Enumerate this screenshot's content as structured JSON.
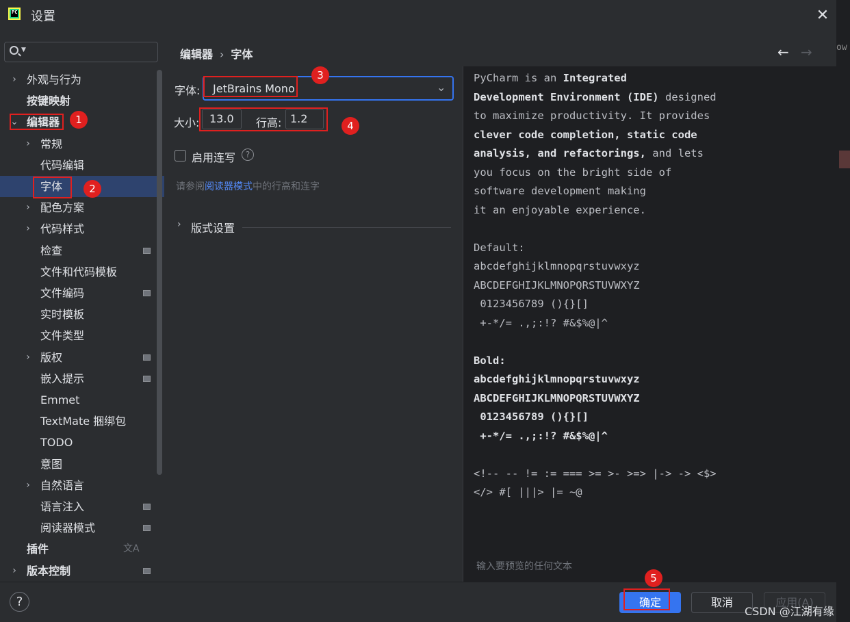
{
  "window": {
    "title": "设置",
    "logo_text": "PC",
    "close_glyph": "✕"
  },
  "sidebar": {
    "search_placeholder": "",
    "items": [
      {
        "label": "外观与行为",
        "arrow": "›",
        "level": 0
      },
      {
        "label": "按键映射",
        "arrow": "",
        "level": 0,
        "bold": true
      },
      {
        "label": "编辑器",
        "arrow": "⌄",
        "level": 0,
        "bold": true
      },
      {
        "label": "常规",
        "arrow": "›",
        "level": 1
      },
      {
        "label": "代码编辑",
        "arrow": "",
        "level": 1
      },
      {
        "label": "字体",
        "arrow": "",
        "level": 1,
        "selected": true
      },
      {
        "label": "配色方案",
        "arrow": "›",
        "level": 1
      },
      {
        "label": "代码样式",
        "arrow": "›",
        "level": 1
      },
      {
        "label": "检查",
        "arrow": "",
        "level": 1,
        "badge": true
      },
      {
        "label": "文件和代码模板",
        "arrow": "",
        "level": 1
      },
      {
        "label": "文件编码",
        "arrow": "",
        "level": 1,
        "badge": true
      },
      {
        "label": "实时模板",
        "arrow": "",
        "level": 1
      },
      {
        "label": "文件类型",
        "arrow": "",
        "level": 1
      },
      {
        "label": "版权",
        "arrow": "›",
        "level": 1,
        "badge": true
      },
      {
        "label": "嵌入提示",
        "arrow": "",
        "level": 1,
        "badge": true
      },
      {
        "label": "Emmet",
        "arrow": "",
        "level": 1
      },
      {
        "label": "TextMate 捆绑包",
        "arrow": "",
        "level": 1
      },
      {
        "label": "TODO",
        "arrow": "",
        "level": 1
      },
      {
        "label": "意图",
        "arrow": "",
        "level": 1
      },
      {
        "label": "自然语言",
        "arrow": "›",
        "level": 1
      },
      {
        "label": "语言注入",
        "arrow": "",
        "level": 1,
        "badge": true
      },
      {
        "label": "阅读器模式",
        "arrow": "",
        "level": 1,
        "badge": true
      },
      {
        "label": "插件",
        "arrow": "",
        "level": 0,
        "bold": true,
        "translate": true
      },
      {
        "label": "版本控制",
        "arrow": "›",
        "level": 0,
        "bold": true,
        "badge": true
      }
    ]
  },
  "header": {
    "breadcrumb": [
      "编辑器",
      "字体"
    ],
    "breadcrumb_sep": "›",
    "back_glyph": "←",
    "forward_glyph": "→"
  },
  "font_settings": {
    "font_label": "字体:",
    "font_value": "JetBrains Mono",
    "size_label": "大小:",
    "size_value": "13.0",
    "line_height_label": "行高:",
    "line_height_value": "1.2",
    "ligatures_label": "启用连写",
    "ligatures_checked": false,
    "hint_prefix": "请参阅",
    "hint_link": "阅读器模式",
    "hint_suffix": "中的行高和连字",
    "layout_section": "版式设置"
  },
  "preview": {
    "footer_placeholder": "输入要预览的任何文本",
    "lines": [
      [
        [
          "PyCharm is an ",
          false
        ],
        [
          "Integrated",
          true
        ]
      ],
      [
        [
          "Development Environment (IDE)",
          true
        ],
        [
          " designed",
          false
        ]
      ],
      [
        [
          "to maximize productivity. It provides",
          false
        ]
      ],
      [
        [
          "clever code completion, static code",
          true
        ]
      ],
      [
        [
          "analysis, and refactorings,",
          true
        ],
        [
          " and lets",
          false
        ]
      ],
      [
        [
          "you focus on the bright side of",
          false
        ]
      ],
      [
        [
          "software development making",
          false
        ]
      ],
      [
        [
          "it an enjoyable experience.",
          false
        ]
      ],
      [
        [
          "",
          false
        ]
      ],
      [
        [
          "Default:",
          false
        ]
      ],
      [
        [
          "abcdefghijklmnopqrstuvwxyz",
          false
        ]
      ],
      [
        [
          "ABCDEFGHIJKLMNOPQRSTUVWXYZ",
          false
        ]
      ],
      [
        [
          " 0123456789 (){}[]",
          false
        ]
      ],
      [
        [
          " +-*/= .,;:!? #&$%@|^",
          false
        ]
      ],
      [
        [
          "",
          false
        ]
      ],
      [
        [
          "Bold:",
          true
        ]
      ],
      [
        [
          "abcdefghijklmnopqrstuvwxyz",
          true
        ]
      ],
      [
        [
          "ABCDEFGHIJKLMNOPQRSTUVWXYZ",
          true
        ]
      ],
      [
        [
          " 0123456789 (){}[]",
          true
        ]
      ],
      [
        [
          " +-*/= .,;:!? #&$%@|^",
          true
        ]
      ],
      [
        [
          "",
          false
        ]
      ],
      [
        [
          "<!-- -- != := === >= >- >=> |-> -> <$>",
          false
        ]
      ],
      [
        [
          "</> #[ |||> |= ~@",
          false
        ]
      ]
    ]
  },
  "buttons": {
    "help": "?",
    "ok": "确定",
    "cancel": "取消",
    "apply": "应用(A)"
  },
  "edge_text": "ow",
  "watermark": "CSDN @江湖有缘",
  "annotations": [
    "1",
    "2",
    "3",
    "4",
    "5"
  ],
  "colors": {
    "accent": "#3574f0",
    "selection": "#2e436e",
    "annotation": "#e0201f",
    "link": "#548af7"
  }
}
